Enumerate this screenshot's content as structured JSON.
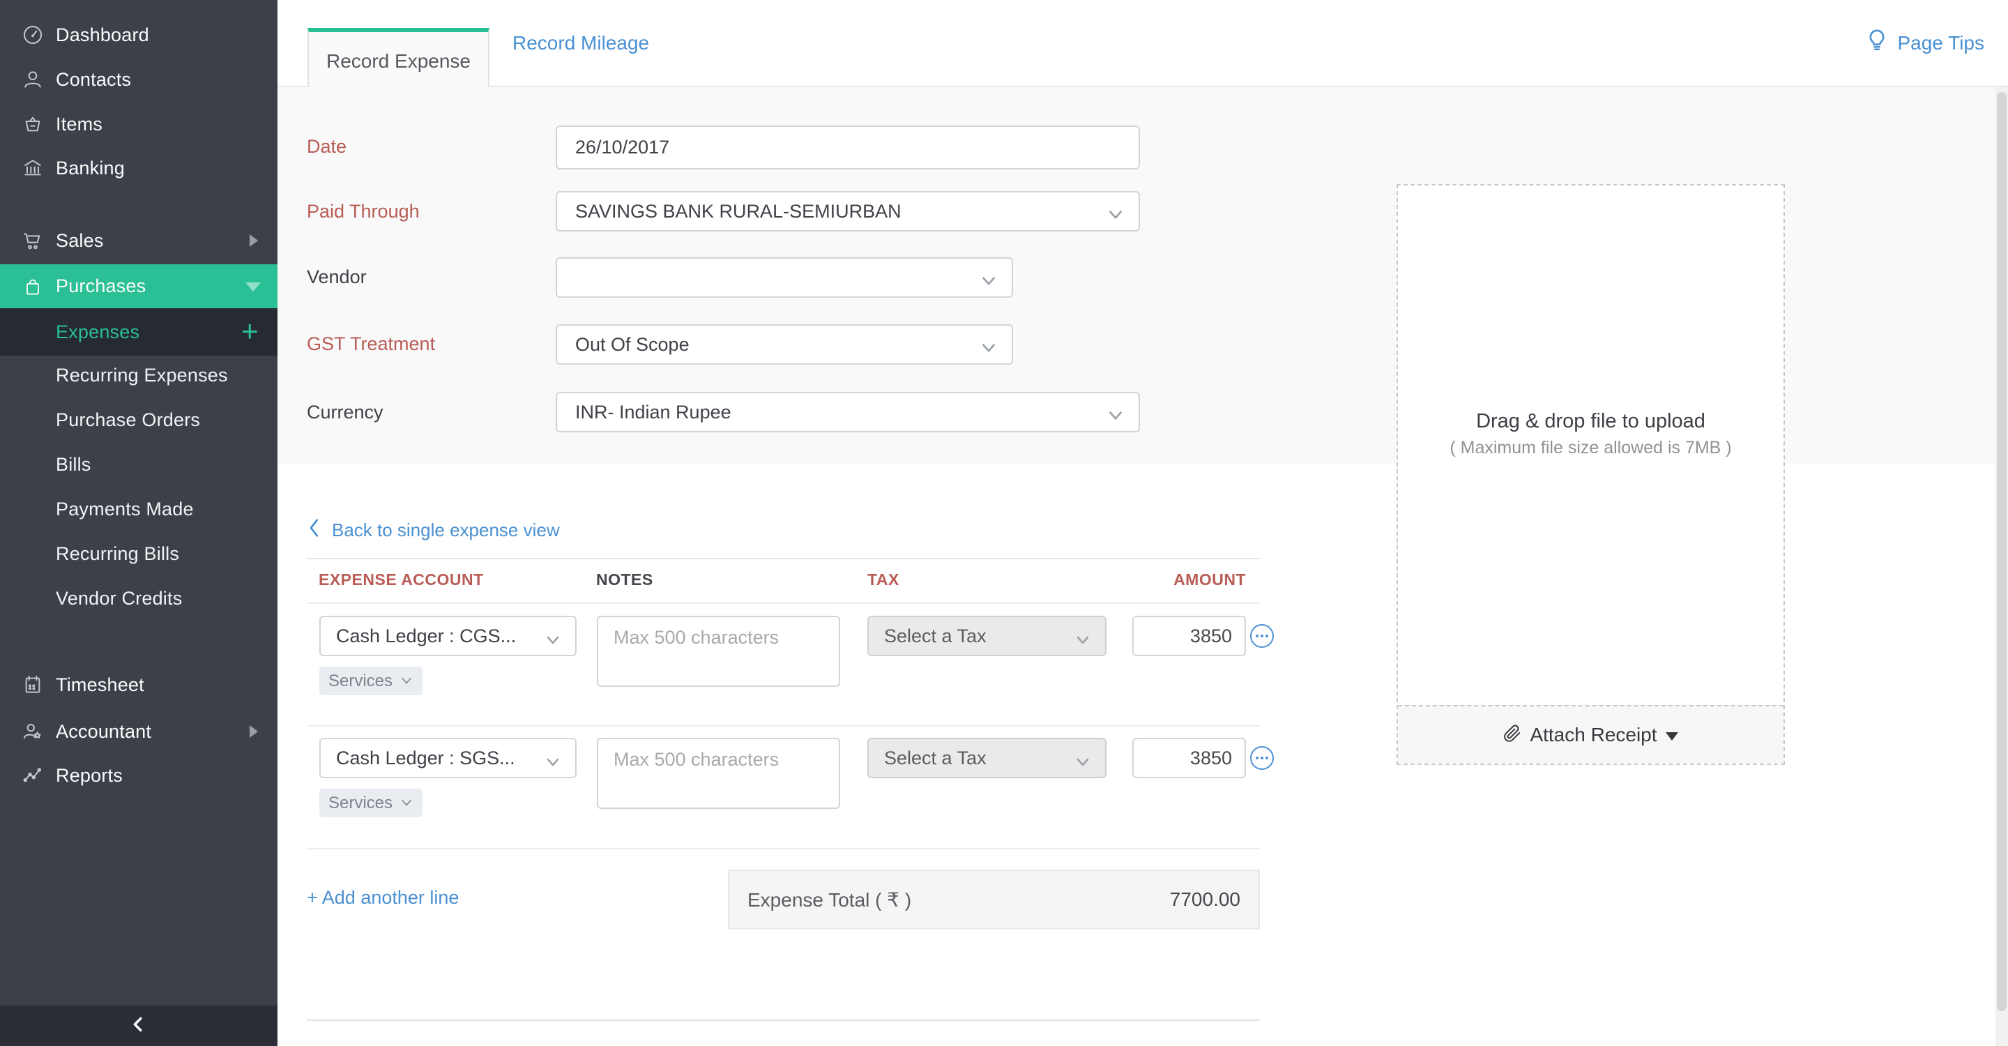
{
  "sidebar": {
    "items": [
      {
        "label": "Dashboard",
        "icon": "gauge-icon"
      },
      {
        "label": "Contacts",
        "icon": "contacts-icon"
      },
      {
        "label": "Items",
        "icon": "items-icon"
      },
      {
        "label": "Banking",
        "icon": "banking-icon"
      },
      {
        "label": "Sales",
        "icon": "sales-icon"
      },
      {
        "label": "Purchases",
        "icon": "purchases-icon"
      },
      {
        "label": "Expenses",
        "icon": "none"
      },
      {
        "label": "Recurring Expenses"
      },
      {
        "label": "Purchase Orders"
      },
      {
        "label": "Bills"
      },
      {
        "label": "Payments Made"
      },
      {
        "label": "Recurring Bills"
      },
      {
        "label": "Vendor Credits"
      },
      {
        "label": "Timesheet",
        "icon": "timesheet-icon"
      },
      {
        "label": "Accountant",
        "icon": "accountant-icon"
      },
      {
        "label": "Reports",
        "icon": "reports-icon"
      }
    ],
    "expenses_add_symbol": "+"
  },
  "tabs": {
    "active": "Record Expense",
    "secondary": "Record Mileage"
  },
  "page_tips_label": "Page Tips",
  "form": {
    "date": {
      "label": "Date",
      "value": "26/10/2017"
    },
    "paid_through": {
      "label": "Paid Through",
      "value": "SAVINGS BANK RURAL-SEMIURBAN"
    },
    "vendor": {
      "label": "Vendor",
      "value": ""
    },
    "gst_treatment": {
      "label": "GST Treatment",
      "value": "Out Of Scope"
    },
    "currency": {
      "label": "Currency",
      "value": "INR- Indian Rupee"
    }
  },
  "back_link_label": "Back to single expense view",
  "table": {
    "headers": [
      "EXPENSE ACCOUNT",
      "NOTES",
      "TAX",
      "AMOUNT"
    ],
    "notes_placeholder": "Max 500 characters",
    "rows": [
      {
        "account": "Cash Ledger : CGS...",
        "item_type": "Services",
        "tax": "Select a Tax",
        "amount": "3850"
      },
      {
        "account": "Cash Ledger : SGS...",
        "item_type": "Services",
        "tax": "Select a Tax",
        "amount": "3850"
      }
    ],
    "add_line_label": "+ Add another line",
    "total_label": "Expense Total ( ₹ )",
    "total_value": "7700.00"
  },
  "upload": {
    "drag_text": "Drag & drop file to upload",
    "size_text": "( Maximum file size allowed is 7MB )",
    "attach_label": "Attach Receipt"
  },
  "colors": {
    "accent_green": "#2abf94",
    "link_blue": "#4a90d2",
    "label_red": "#b85c55",
    "sidebar_bg": "#3d4049",
    "sidebar_active_bg": "#262a31",
    "panel_gray": "#f9f9f9"
  }
}
